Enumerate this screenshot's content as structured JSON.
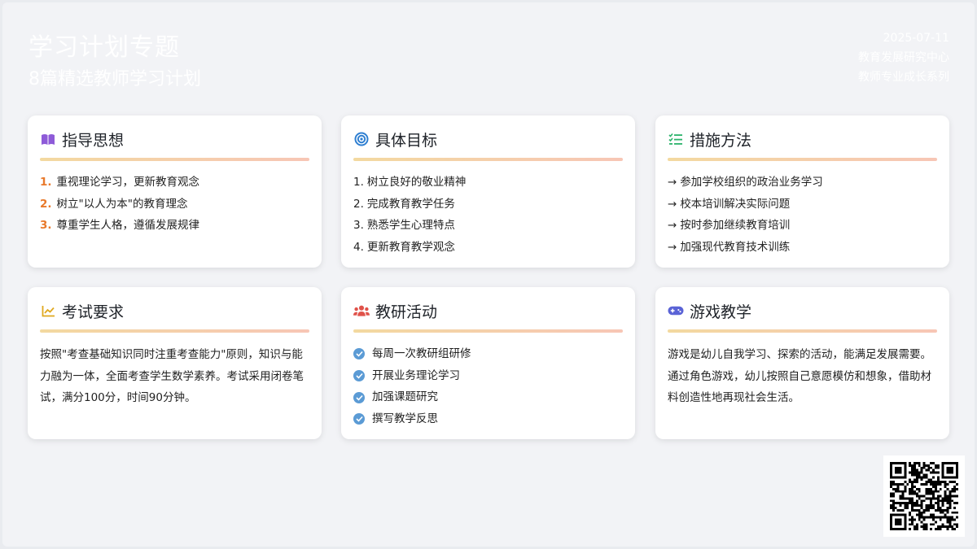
{
  "header": {
    "title": "学习计划专题",
    "subtitle": "8篇精选教师学习计划",
    "date": "2025-07-11",
    "org": "教育发展研究中心",
    "series": "教师专业成长系列"
  },
  "cards": {
    "guiding": {
      "title": "指导思想",
      "icon": "book-icon",
      "items": [
        {
          "num": "1.",
          "text": "重视理论学习，更新教育观念"
        },
        {
          "num": "2.",
          "text": "树立\"以人为本\"的教育理念"
        },
        {
          "num": "3.",
          "text": "尊重学生人格，遵循发展规律"
        }
      ]
    },
    "goals": {
      "title": "具体目标",
      "icon": "target-icon",
      "items": [
        {
          "num": "1.",
          "text": "树立良好的敬业精神"
        },
        {
          "num": "2.",
          "text": "完成教育教学任务"
        },
        {
          "num": "3.",
          "text": "熟悉学生心理特点"
        },
        {
          "num": "4.",
          "text": "更新教育教学观念"
        }
      ]
    },
    "measures": {
      "title": "措施方法",
      "icon": "checklist-icon",
      "items": [
        {
          "arrow": "→",
          "text": "参加学校组织的政治业务学习"
        },
        {
          "arrow": "→",
          "text": "校本培训解决实际问题"
        },
        {
          "arrow": "→",
          "text": "按时参加继续教育培训"
        },
        {
          "arrow": "→",
          "text": "加强现代教育技术训练"
        }
      ]
    },
    "exam": {
      "title": "考试要求",
      "icon": "line-chart-icon",
      "text": "按照\"考查基础知识同时注重考查能力\"原则，知识与能力融为一体，全面考查学生数学素养。考试采用闭卷笔试，满分100分，时间90分钟。"
    },
    "research": {
      "title": "教研活动",
      "icon": "users-icon",
      "items": [
        "每周一次教研组研修",
        "开展业务理论学习",
        "加强课题研究",
        "撰写教学反思"
      ]
    },
    "games": {
      "title": "游戏教学",
      "icon": "gamepad-icon",
      "text": "游戏是幼儿自我学习、探索的活动，能满足发展需要。通过角色游戏，幼儿按照自己意愿模仿和想象，借助材料创造性地再现社会生活。"
    }
  },
  "colors": {
    "accent_orange": "#e8792b",
    "check_blue": "#5b9bd5",
    "book_purple": "#8e5bd8",
    "target_blue": "#2f7fd1",
    "checklist_green": "#2bb36b",
    "chart_yellow": "#e0a81e",
    "users_red": "#e0524a",
    "gamepad_indigo": "#5a63d6"
  },
  "qr": {
    "icon": "qr-code-icon"
  }
}
